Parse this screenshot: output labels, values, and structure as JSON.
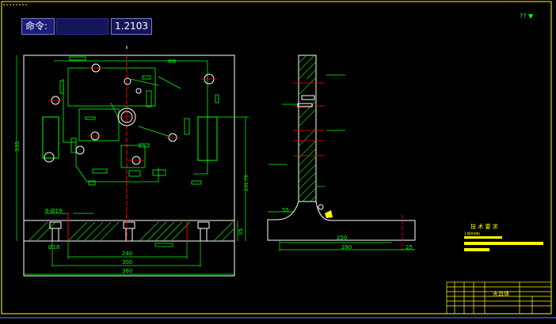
{
  "command_line": {
    "label": "命令:",
    "input_value": "",
    "value": "1.2103"
  },
  "drawing": {
    "dimensions": {
      "d_335": "335",
      "d_240": "240",
      "d_300": "300",
      "d_360": "360",
      "d_35": "35",
      "d_231": "231.76",
      "d_6phi19": "6-Ø19",
      "d_phi18": "Ø18",
      "d_55": "55",
      "d_250": "250",
      "d_280": "280",
      "d_25": "25"
    },
    "tech_requirements": {
      "title": "技 术 要 求",
      "line1": "1.铸件材料"
    },
    "title_block": {
      "name": "夹具体"
    },
    "top_right_marks": "?? ▼"
  },
  "colors": {
    "background": "#000000",
    "frame": "#ffff00",
    "outline": "#ffffff",
    "geometry": "#00ff00",
    "centerline": "#ff0000",
    "title_block": "#ffff00"
  }
}
